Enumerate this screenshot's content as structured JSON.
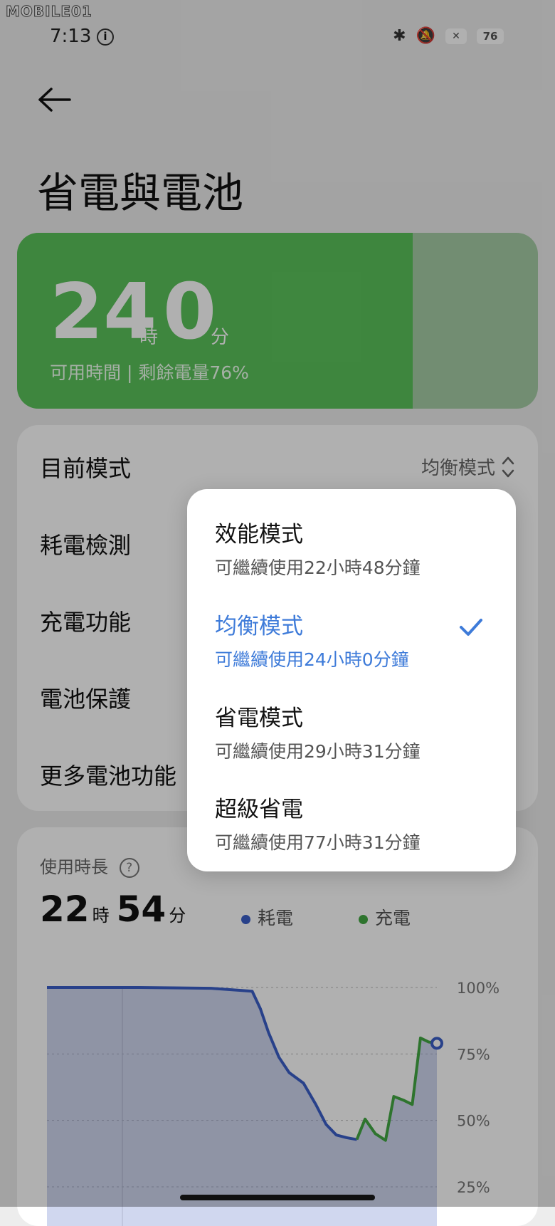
{
  "watermark": "MOBILE01",
  "status": {
    "time": "7:13",
    "battery": "76",
    "x_badge": "✕"
  },
  "header": {
    "title": "省電與電池"
  },
  "hero": {
    "hours": "24",
    "hours_unit": "時",
    "minutes": "0",
    "minutes_unit": "分",
    "subtitle": "可用時間 | 剩餘電量76%",
    "level_percent": 76
  },
  "settings": {
    "current_mode_label": "目前模式",
    "current_mode_value": "均衡模式",
    "items": [
      "耗電檢測",
      "充電功能",
      "電池保護",
      "更多電池功能"
    ]
  },
  "usage": {
    "label": "使用時長",
    "hours": "22",
    "hours_unit": "時",
    "minutes": "54",
    "minutes_unit": "分",
    "legend": [
      {
        "name": "耗電",
        "color": "#3b5fc8"
      },
      {
        "name": "充電",
        "color": "#43a843"
      }
    ],
    "y_ticks": [
      "100%",
      "75%",
      "50%",
      "25%"
    ]
  },
  "chart_data": {
    "type": "line",
    "yticks": [
      "100%",
      "75%",
      "50%",
      "25%"
    ],
    "ylim": [
      25,
      100
    ],
    "x": [
      0,
      3.5,
      4.5,
      8,
      10,
      10.4,
      10.8,
      11.3,
      11.8,
      12.5,
      13.1,
      13.6,
      14.1,
      14.6,
      15.1,
      15.5,
      16,
      16.5,
      16.9,
      17.4,
      17.8,
      18.2,
      18.6,
      19.0
    ],
    "series": [
      {
        "name": "耗電",
        "values": [
          100,
          100,
          100,
          99.7,
          98.6,
          92,
          83,
          73.8,
          68,
          64,
          56,
          48.5,
          44.5,
          43.5,
          42.8,
          null,
          null,
          null,
          null,
          null,
          null,
          null,
          null,
          null
        ]
      },
      {
        "name": "充電",
        "values": [
          null,
          null,
          null,
          null,
          null,
          null,
          null,
          null,
          null,
          null,
          null,
          null,
          null,
          null,
          42.8,
          50.5,
          45,
          42.5,
          59,
          57.5,
          56,
          81,
          79.5,
          79
        ]
      }
    ]
  },
  "popup": {
    "options": [
      {
        "name": "效能模式",
        "desc": "可繼續使用22小時48分鐘"
      },
      {
        "name": "均衡模式",
        "desc": "可繼續使用24小時0分鐘"
      },
      {
        "name": "省電模式",
        "desc": "可繼續使用29小時31分鐘"
      },
      {
        "name": "超級省電",
        "desc": "可繼續使用77小時31分鐘"
      }
    ],
    "selected_index": 1,
    "accent": "#3e7bd9"
  }
}
